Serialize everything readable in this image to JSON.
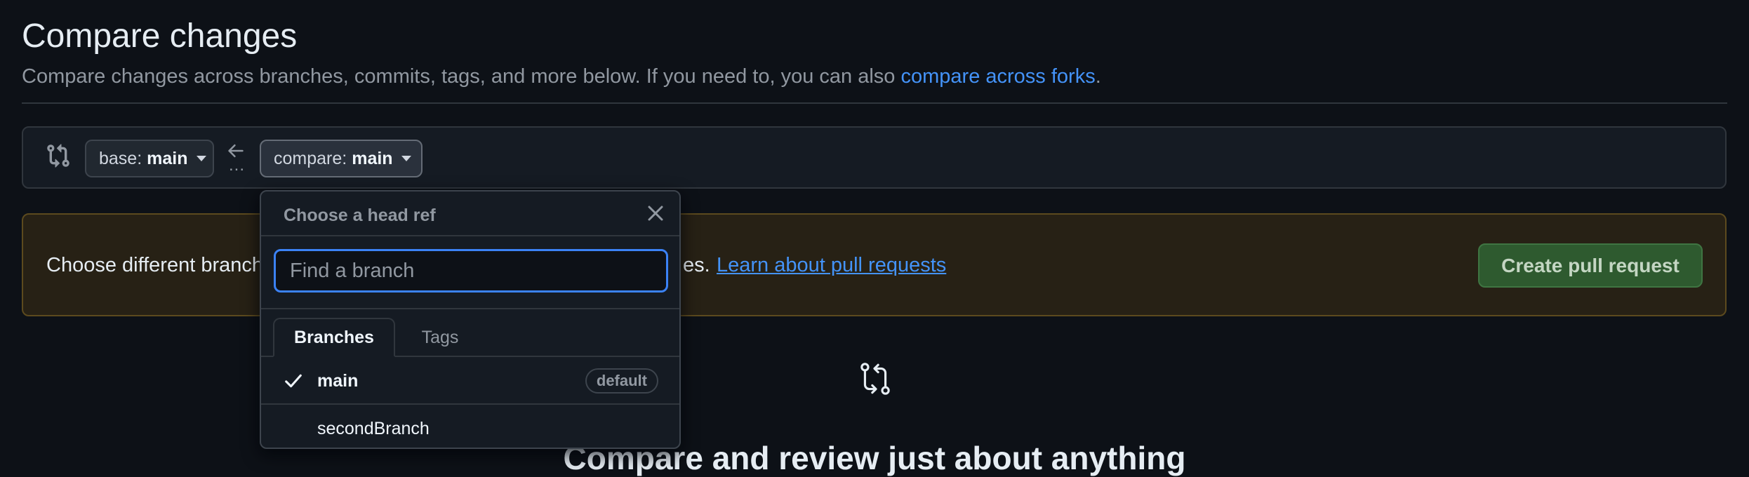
{
  "header": {
    "title": "Compare changes",
    "subtitle": "Compare changes across branches, commits, tags, and more below. If you need to, you can also ",
    "fork_link": "compare across forks",
    "subtitle_end": "."
  },
  "range": {
    "base_prefix": "base:",
    "base_value": "main",
    "compare_prefix": "compare:",
    "compare_value": "main",
    "ellipsis": "..."
  },
  "flash": {
    "text": "Choose different branch",
    "text_tail": "es.",
    "link": "Learn about pull requests",
    "button": "Create pull request"
  },
  "blankslate": {
    "title": "Compare and review just about anything"
  },
  "popover": {
    "title": "Choose a head ref",
    "search_placeholder": "Find a branch",
    "tabs": [
      "Branches",
      "Tags"
    ],
    "refs": [
      {
        "name": "main",
        "selected": true,
        "badge": "default"
      },
      {
        "name": "secondBranch",
        "selected": false,
        "badge": ""
      }
    ]
  },
  "colors": {
    "link": "#4493f8",
    "create_button_bg": "#2e5a2f",
    "flash_bg": "#272115",
    "focus_ring": "#3b82f6"
  },
  "icons": [
    "git-compare-icon",
    "arrow-left-icon",
    "close-icon",
    "check-icon"
  ]
}
